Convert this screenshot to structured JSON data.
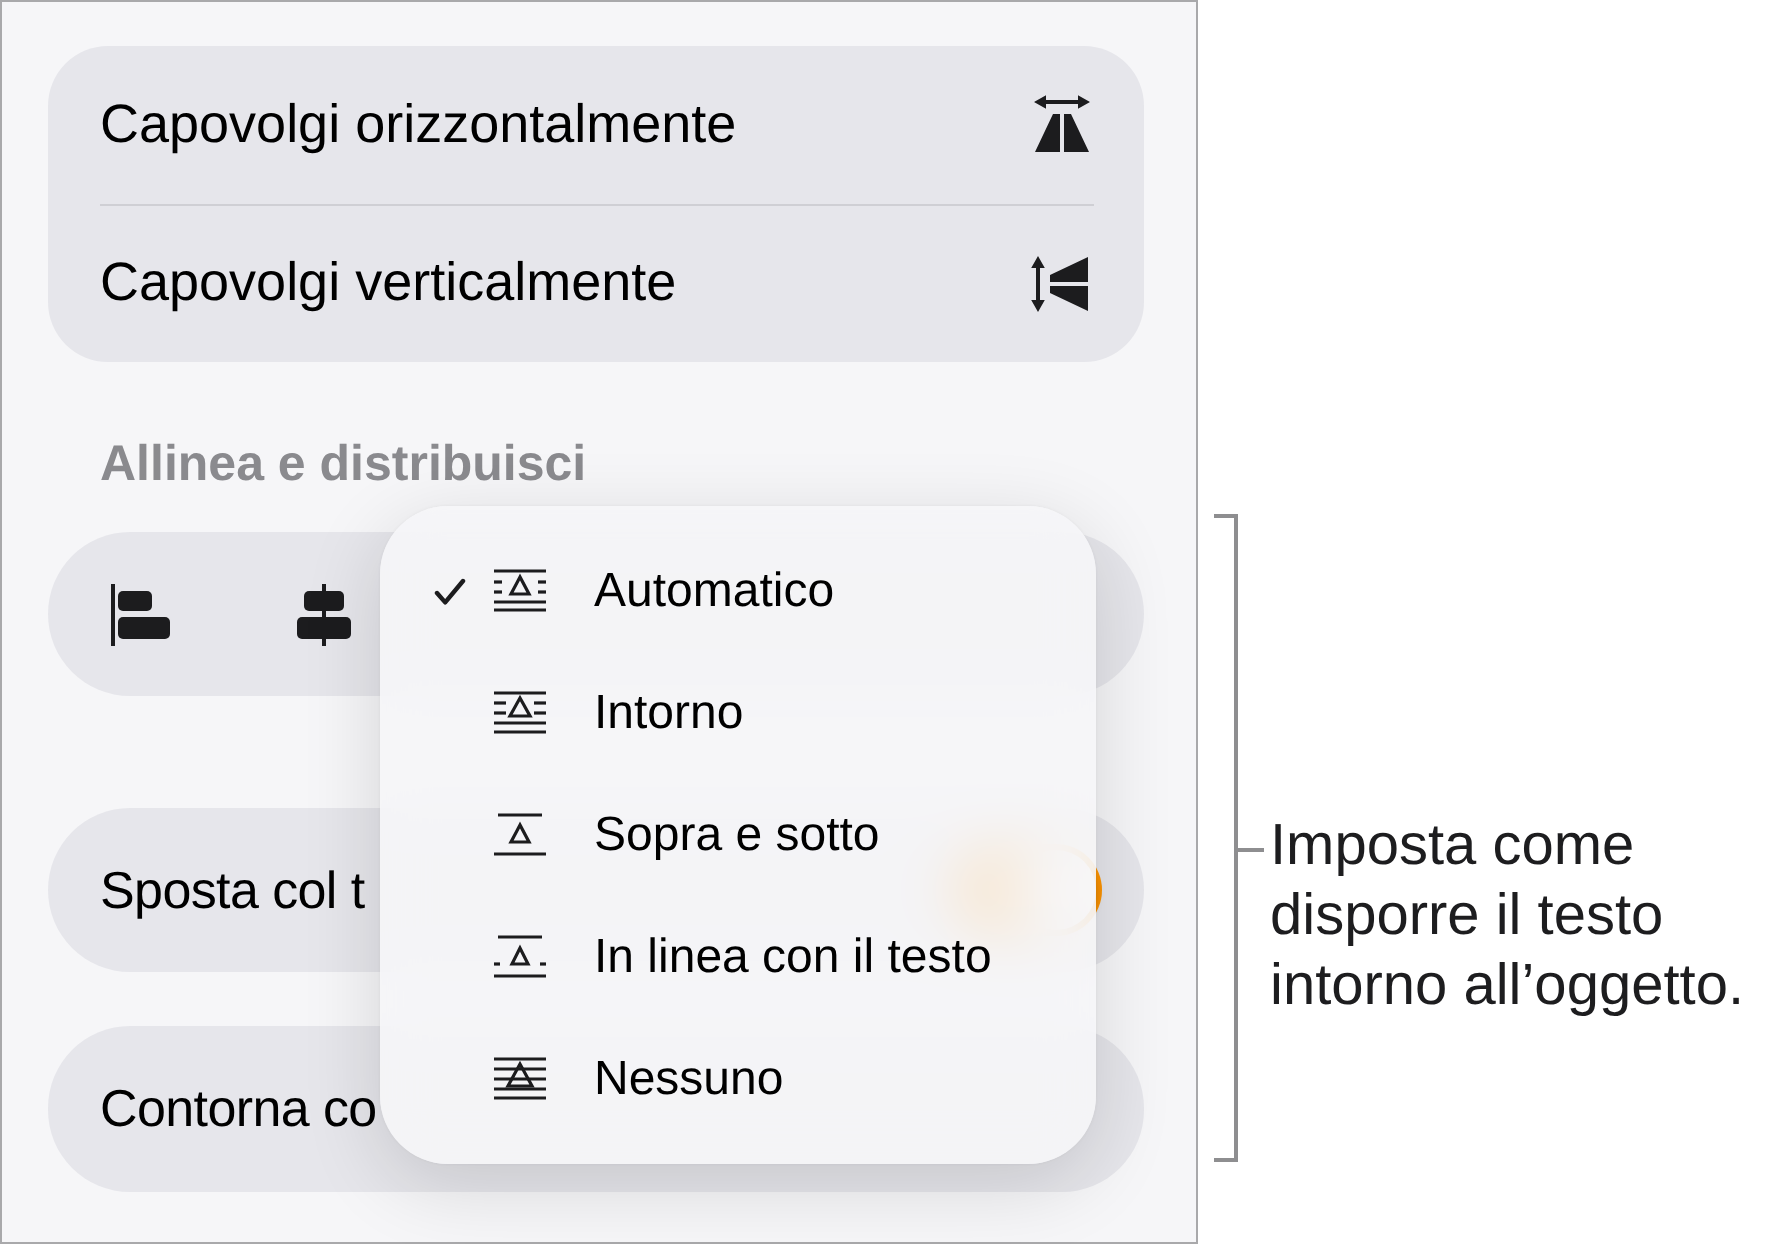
{
  "flip_options": [
    {
      "kind": "horizontal",
      "label": "Capovolgi orizzontalmente"
    },
    {
      "kind": "vertical",
      "label": "Capovolgi verticalmente"
    }
  ],
  "align_section": {
    "heading": "Allinea e distribuisci"
  },
  "move_with_text": {
    "label": "Sposta col t",
    "on": true
  },
  "text_wrap": {
    "label": "Contorna co"
  },
  "wrap_menu": {
    "items": [
      {
        "kind": "automatic",
        "label": "Automatico",
        "selected": true
      },
      {
        "kind": "around",
        "label": "Intorno",
        "selected": false
      },
      {
        "kind": "above_below",
        "label": "Sopra e sotto",
        "selected": false
      },
      {
        "kind": "inline",
        "label": "In linea con il testo",
        "selected": false
      },
      {
        "kind": "none",
        "label": "Nessuno",
        "selected": false
      }
    ]
  },
  "callout": {
    "text": "Imposta come disporre il testo intorno all’oggetto."
  }
}
